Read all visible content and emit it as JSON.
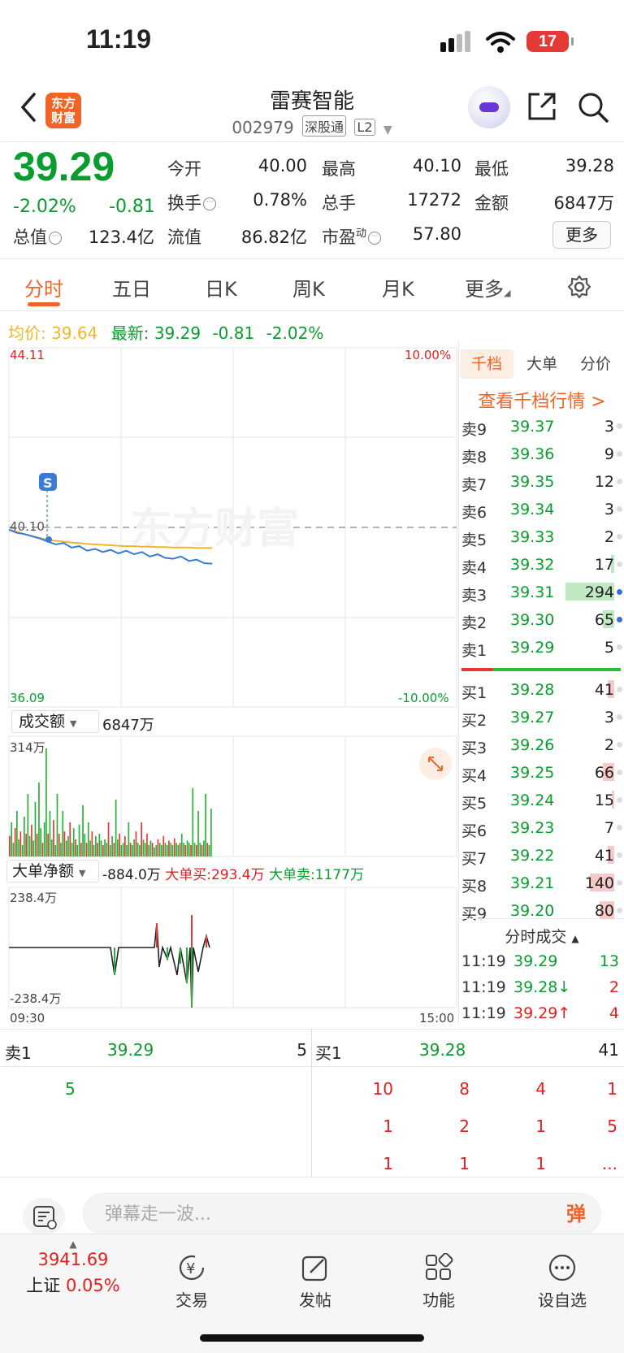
{
  "status": {
    "time": "11:19",
    "battery": "17"
  },
  "header": {
    "logo_line1": "东方",
    "logo_line2": "财富",
    "title": "雷赛智能",
    "code": "002979",
    "tag_connect": "深股通",
    "tag_level": "L2"
  },
  "quote": {
    "price": "39.29",
    "pct": "-2.02%",
    "change": "-0.81",
    "open_label": "今开",
    "open": "40.00",
    "high_label": "最高",
    "high": "40.10",
    "low_label": "最低",
    "low": "39.28",
    "turnover_label": "换手",
    "turnover": "0.78%",
    "volume_label": "总手",
    "volume": "17272",
    "amount_label": "金额",
    "amount": "6847万",
    "mktcap_label": "总值",
    "mktcap": "123.4亿",
    "float_label": "流值",
    "float_cap": "86.82亿",
    "pe_label": "市盈",
    "pe_sup": "动",
    "pe": "57.80",
    "more_label": "更多"
  },
  "tabs": [
    "分时",
    "五日",
    "日K",
    "周K",
    "月K",
    "更多"
  ],
  "avg_row": {
    "avg_label": "均价:",
    "avg": "39.64",
    "latest_label": "最新:",
    "latest": "39.29",
    "change": "-0.81",
    "pct": "-2.02%"
  },
  "chart": {
    "y_max": "44.11",
    "y_min": "36.09",
    "pct_max": "10.00%",
    "pct_min": "-10.00%",
    "prev_close": "40.10",
    "watermark": "东方财富",
    "vol_selector": "成交额",
    "vol_total": "6847万",
    "vol_max": "314万",
    "net_selector": "大单净额",
    "net_value": "-884.0万",
    "big_buy": "大单买:293.4万",
    "big_sell": "大单卖:1177万",
    "net_max": "238.4万",
    "net_min": "-238.4万",
    "t_start": "09:30",
    "t_end": "15:00",
    "badge": "S"
  },
  "chart_data": {
    "type": "line",
    "ylim": [
      36.09,
      44.11
    ],
    "prev_close": 40.1,
    "series": [
      {
        "values": [
          40.05,
          39.98,
          39.95,
          39.9,
          39.85,
          39.78,
          39.72,
          39.75,
          39.65,
          39.68,
          39.58,
          39.62,
          39.55,
          39.6,
          39.52,
          39.58,
          39.5,
          39.55,
          39.45,
          39.5,
          39.42,
          39.4,
          39.45,
          39.35,
          39.38,
          39.3,
          39.29
        ]
      },
      {
        "values": [
          40.05,
          40.0,
          39.95,
          39.9,
          39.86,
          39.82,
          39.8,
          39.78,
          39.76,
          39.75,
          39.73,
          39.72,
          39.71,
          39.7,
          39.69,
          39.68,
          39.68,
          39.67,
          39.67,
          39.66,
          39.66,
          39.65,
          39.65,
          39.65,
          39.64,
          39.64,
          39.64
        ]
      }
    ]
  },
  "orderbook": {
    "tabs": [
      "千档",
      "大单",
      "分价"
    ],
    "link": "查看千档行情 >",
    "asks": [
      {
        "label": "卖9",
        "price": "39.37",
        "vol": "3",
        "w": 0
      },
      {
        "label": "卖8",
        "price": "39.36",
        "vol": "9",
        "w": 0
      },
      {
        "label": "卖7",
        "price": "39.35",
        "vol": "12",
        "w": 0
      },
      {
        "label": "卖6",
        "price": "39.34",
        "vol": "3",
        "w": 0
      },
      {
        "label": "卖5",
        "price": "39.33",
        "vol": "2",
        "w": 0
      },
      {
        "label": "卖4",
        "price": "39.32",
        "vol": "17",
        "w": 4
      },
      {
        "label": "卖3",
        "price": "39.31",
        "vol": "294",
        "w": 60
      },
      {
        "label": "卖2",
        "price": "39.30",
        "vol": "65",
        "w": 14
      },
      {
        "label": "卖1",
        "price": "39.29",
        "vol": "5",
        "w": 0
      }
    ],
    "bids": [
      {
        "label": "买1",
        "price": "39.28",
        "vol": "41",
        "w": 8
      },
      {
        "label": "买2",
        "price": "39.27",
        "vol": "3",
        "w": 0
      },
      {
        "label": "买3",
        "price": "39.26",
        "vol": "2",
        "w": 0
      },
      {
        "label": "买4",
        "price": "39.25",
        "vol": "66",
        "w": 14
      },
      {
        "label": "买5",
        "price": "39.24",
        "vol": "15",
        "w": 3
      },
      {
        "label": "买6",
        "price": "39.23",
        "vol": "7",
        "w": 0
      },
      {
        "label": "买7",
        "price": "39.22",
        "vol": "41",
        "w": 8
      },
      {
        "label": "买8",
        "price": "39.21",
        "vol": "140",
        "w": 30
      },
      {
        "label": "买9",
        "price": "39.20",
        "vol": "80",
        "w": 18
      }
    ],
    "ticks_head": "分时成交",
    "ticks": [
      {
        "time": "11:19",
        "price": "39.29",
        "vol": "13",
        "color": "green"
      },
      {
        "time": "11:19",
        "price": "39.28↓",
        "vol": "2",
        "color": "green"
      },
      {
        "time": "11:19",
        "price": "39.29↑",
        "vol": "4",
        "color": "red"
      }
    ]
  },
  "queue": {
    "sell_label": "卖1",
    "sell_price": "39.29",
    "sell_vol": "5",
    "buy_label": "买1",
    "buy_price": "39.28",
    "buy_vol": "41",
    "sell_orders": [
      "5"
    ],
    "buy_orders": [
      [
        "10",
        "8",
        "4",
        "1"
      ],
      [
        "1",
        "2",
        "1",
        "5"
      ],
      [
        "1",
        "1",
        "1",
        "..."
      ]
    ]
  },
  "danmu": {
    "placeholder": "弹幕走一波...",
    "send": "弹"
  },
  "nav": {
    "index_value": "3941.69",
    "index_name": "上证",
    "index_pct": "0.05%",
    "trade": "交易",
    "post": "发帖",
    "func": "功能",
    "watch": "设自选"
  }
}
